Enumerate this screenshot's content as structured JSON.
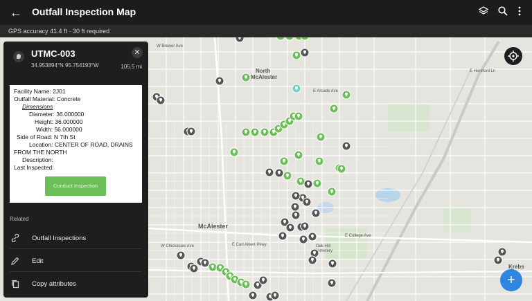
{
  "app": {
    "title": "Outfall Inspection Map"
  },
  "status": {
    "gps_text": "GPS accuracy 41.4 ft  ·  30 ft required"
  },
  "feature": {
    "id": "UTMC-003",
    "coords": "34.953894°N  95.754193°W",
    "distance": "105.5 mi",
    "close_glyph": "✕"
  },
  "popup": {
    "facility_name": "Facility Name: 2J01",
    "outfall_material": "Outfall Material: Concrete",
    "dimensions_header": "Dimensions",
    "diameter": "Diameter: 36.000000",
    "height": "Height: 36.000000",
    "width": "Width: 56.000000",
    "side_of_road": "Side of Road: N 7th St",
    "location_1": "Location: CENTER OF ROAD, DRAINS",
    "location_2": "FROM THE NORTH",
    "description": "Description:",
    "last_inspected": "Last Inspected:",
    "conduct_button": "Conduct Inspection"
  },
  "related": {
    "header": "Related",
    "items": [
      {
        "label": "Outfall Inspections",
        "icon": "link-icon"
      },
      {
        "label": "Edit",
        "icon": "pencil-icon"
      },
      {
        "label": "Copy attributes",
        "icon": "copy-icon"
      }
    ]
  },
  "map": {
    "labels": {
      "north_mcalester": "North\nMcAlester",
      "mcalester": "McAlester",
      "oak_hill_cemetery": "Oak Hill\nCemetery",
      "krebs": "Krebs",
      "e_arcade": "E Arcade Ave",
      "e_college": "E College Ave",
      "e_hereford": "E Hereford Ln",
      "w_brewer": "W Brewer Ave",
      "w_chickasaw": "W Chickasaw Ave",
      "e_carl_albert": "E Carl Albert Pkwy"
    },
    "colors": {
      "inspected": "#6cbf58",
      "pending": "#555555",
      "selected": "#6fd0c5"
    }
  }
}
